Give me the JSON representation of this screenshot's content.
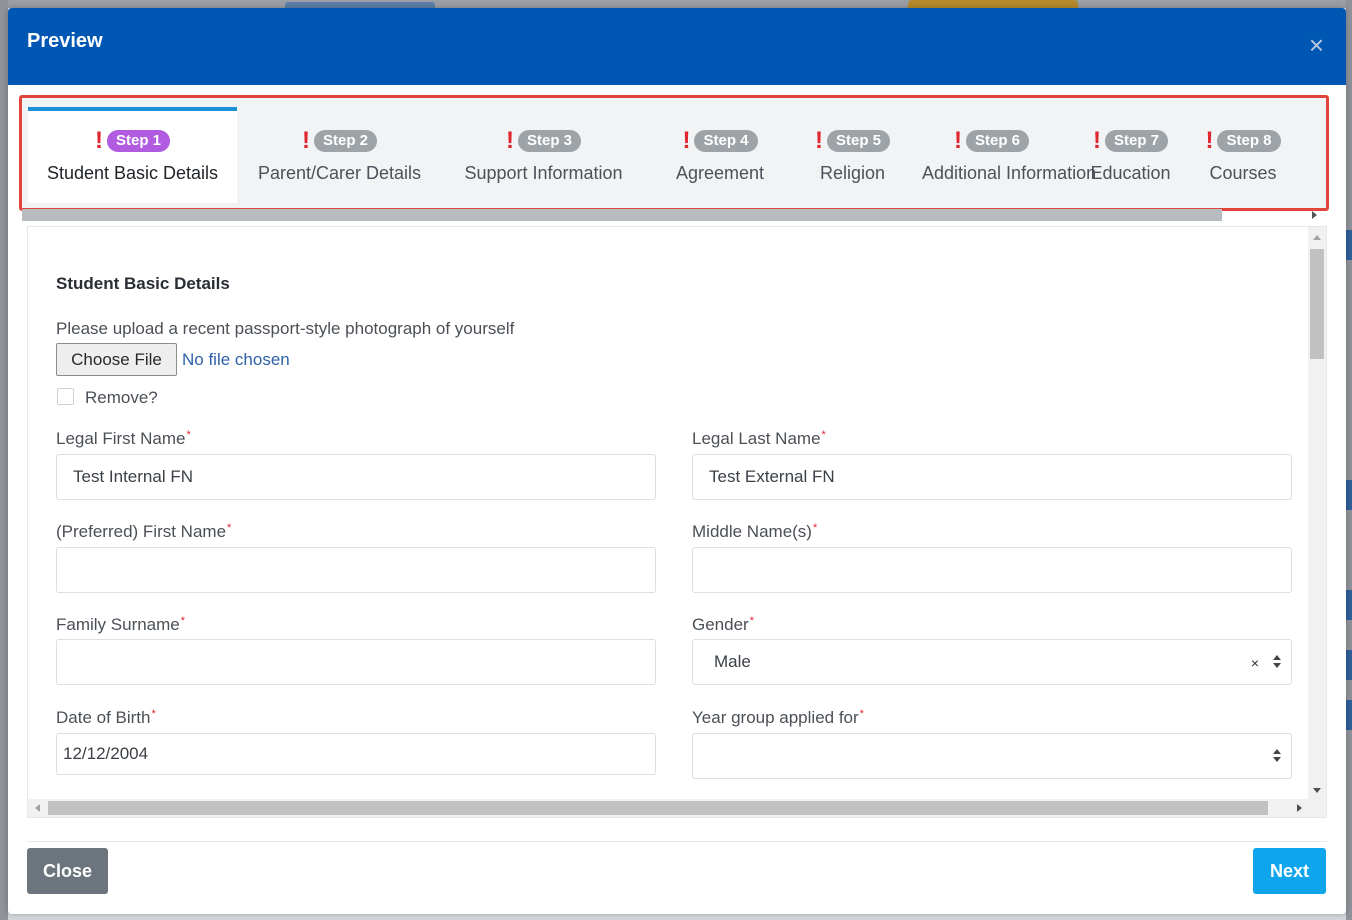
{
  "modal": {
    "title": "Preview",
    "close_symbol": "×"
  },
  "tabs": [
    {
      "step": "Step 1",
      "label": "Student Basic Details",
      "active": true
    },
    {
      "step": "Step 2",
      "label": "Parent/Carer Details",
      "active": false
    },
    {
      "step": "Step 3",
      "label": "Support Information",
      "active": false
    },
    {
      "step": "Step 4",
      "label": "Agreement",
      "active": false
    },
    {
      "step": "Step 5",
      "label": "Religion",
      "active": false
    },
    {
      "step": "Step 6",
      "label": "Additional Information",
      "active": false
    },
    {
      "step": "Step 7",
      "label": "Education",
      "active": false
    },
    {
      "step": "Step 8",
      "label": "Courses",
      "active": false
    }
  ],
  "tab_warning_symbol": "!",
  "form": {
    "section_title": "Student Basic Details",
    "upload_label": "Please upload a recent passport-style photograph of yourself",
    "choose_file_label": "Choose File",
    "no_file_text": "No file chosen",
    "remove_label": "Remove?",
    "required_mark": "*",
    "legal_first_name": {
      "label": "Legal First Name",
      "value": "Test Internal FN"
    },
    "legal_last_name": {
      "label": "Legal Last Name",
      "value": "Test External FN"
    },
    "preferred_first_name": {
      "label": "(Preferred) First Name",
      "value": ""
    },
    "middle_names": {
      "label": "Middle Name(s)",
      "value": ""
    },
    "family_surname": {
      "label": "Family Surname",
      "value": ""
    },
    "gender": {
      "label": "Gender",
      "value": "Male",
      "clear_symbol": "×"
    },
    "date_of_birth": {
      "label": "Date of Birth",
      "value": "12/12/2004"
    },
    "year_group": {
      "label": "Year group applied for",
      "value": ""
    }
  },
  "footer": {
    "close_label": "Close",
    "next_label": "Next"
  },
  "colors": {
    "header": "#0056b3",
    "active_badge": "#b05be0",
    "inactive_badge": "#9ea3a8",
    "warning": "#e0262e",
    "highlight_border": "#e0443a",
    "next_button": "#0ea5ec",
    "close_button": "#6c757d"
  }
}
